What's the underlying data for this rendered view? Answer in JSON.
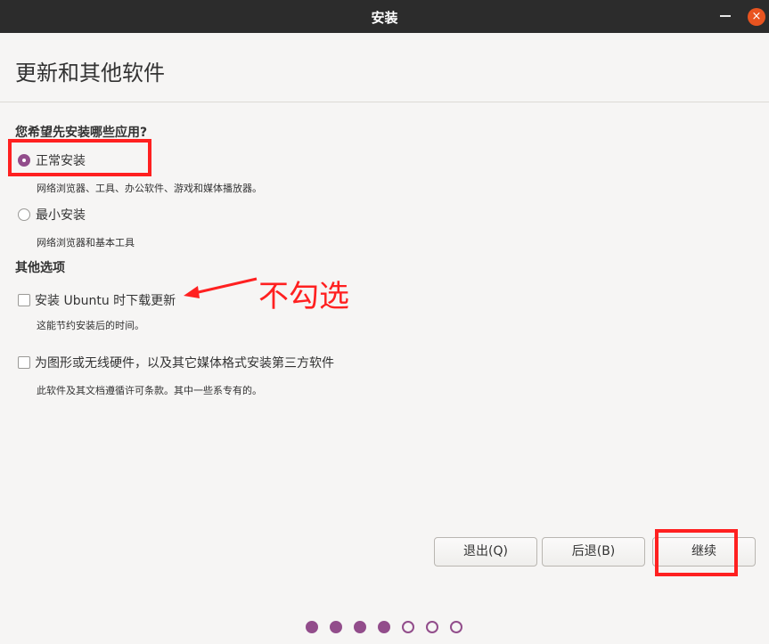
{
  "window": {
    "title": "安装",
    "close_label": "×"
  },
  "header": {
    "title": "更新和其他软件"
  },
  "install_type": {
    "heading": "您希望先安装哪些应用?",
    "normal": {
      "label": "正常安装",
      "desc": "网络浏览器、工具、办公软件、游戏和媒体播放器。",
      "selected": true
    },
    "minimal": {
      "label": "最小安装",
      "desc": "网络浏览器和基本工具",
      "selected": false
    }
  },
  "other_options": {
    "heading": "其他选项",
    "download_updates": {
      "label": "安装 Ubuntu 时下载更新",
      "desc": "这能节约安装后的时间。",
      "checked": false
    },
    "third_party": {
      "label": "为图形或无线硬件，以及其它媒体格式安装第三方软件",
      "desc": "此软件及其文档遵循许可条款。其中一些系专有的。",
      "checked": false
    }
  },
  "annotation": {
    "text": "不勾选",
    "color": "#ff2020"
  },
  "buttons": {
    "quit": "退出(Q)",
    "back": "后退(B)",
    "continue": "继续"
  },
  "progress": {
    "total_steps": 7,
    "completed_steps": 4
  },
  "colors": {
    "accent": "#924d8b",
    "close": "#e95420",
    "titlebar": "#2c2c2c",
    "highlight": "#ff2020"
  }
}
